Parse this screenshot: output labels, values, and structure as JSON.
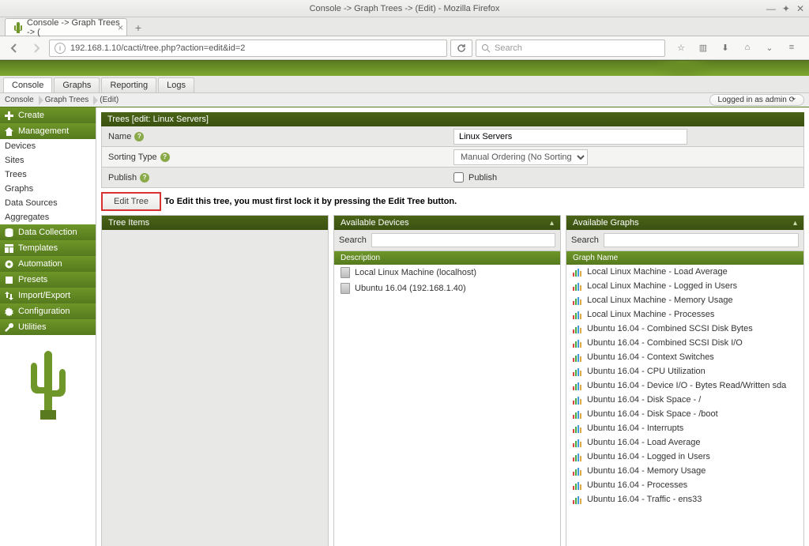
{
  "window": {
    "title": "Console -> Graph Trees -> (Edit) - Mozilla Firefox"
  },
  "browser": {
    "tab_title": "Console -> Graph Trees -> (",
    "url": "192.168.1.10/cacti/tree.php?action=edit&id=2",
    "search_placeholder": "Search"
  },
  "subtabs": [
    "Console",
    "Graphs",
    "Reporting",
    "Logs"
  ],
  "breadcrumb": [
    "Console",
    "Graph Trees",
    "(Edit)"
  ],
  "login_text": "Logged in as admin ",
  "leftnav": {
    "create": "Create",
    "management": "Management",
    "mgmt_items": [
      "Devices",
      "Sites",
      "Trees",
      "Graphs",
      "Data Sources",
      "Aggregates"
    ],
    "data_collection": "Data Collection",
    "templates": "Templates",
    "automation": "Automation",
    "presets": "Presets",
    "import_export": "Import/Export",
    "configuration": "Configuration",
    "utilities": "Utilities"
  },
  "panel": {
    "title": "Trees [edit: Linux Servers]",
    "name_label": "Name",
    "name_value": "Linux Servers",
    "sorting_label": "Sorting Type",
    "sorting_value": "Manual Ordering (No Sorting)",
    "publish_label": "Publish",
    "publish_checkbox_label": "Publish",
    "edit_button": "Edit Tree",
    "edit_message": "To Edit this tree, you must first lock it by pressing the Edit Tree button."
  },
  "tree_items_header": "Tree Items",
  "available_devices": {
    "header": "Available Devices",
    "search_label": "Search",
    "subhead": "Description",
    "items": [
      "Local Linux Machine (localhost)",
      "Ubuntu 16.04 (192.168.1.40)"
    ]
  },
  "available_graphs": {
    "header": "Available Graphs",
    "search_label": "Search",
    "subhead": "Graph Name",
    "items": [
      "Local Linux Machine - Load Average",
      "Local Linux Machine - Logged in Users",
      "Local Linux Machine - Memory Usage",
      "Local Linux Machine - Processes",
      "Ubuntu 16.04 - Combined SCSI Disk Bytes",
      "Ubuntu 16.04 - Combined SCSI Disk I/O",
      "Ubuntu 16.04 - Context Switches",
      "Ubuntu 16.04 - CPU Utilization",
      "Ubuntu 16.04 - Device I/O - Bytes Read/Written sda",
      "Ubuntu 16.04 - Disk Space - /",
      "Ubuntu 16.04 - Disk Space - /boot",
      "Ubuntu 16.04 - Interrupts",
      "Ubuntu 16.04 - Load Average",
      "Ubuntu 16.04 - Logged in Users",
      "Ubuntu 16.04 - Memory Usage",
      "Ubuntu 16.04 - Processes",
      "Ubuntu 16.04 - Traffic - ens33"
    ]
  }
}
